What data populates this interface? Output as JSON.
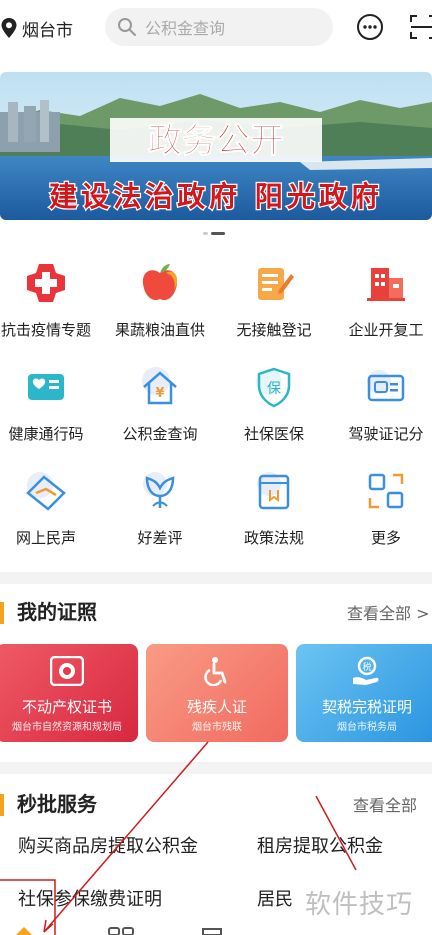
{
  "header": {
    "location": "烟台市",
    "search_placeholder": "公积金查询",
    "icons": [
      "location-pin-icon",
      "search-icon",
      "message-icon",
      "scan-icon"
    ]
  },
  "banner": {
    "title": "政务公开",
    "subtitle": "建设法治政府 阳光政府",
    "slides": 2,
    "active_slide": 2
  },
  "grid": [
    {
      "label": "抗击疫情专题",
      "icon": "medical-cross-icon",
      "color": "#e8343a"
    },
    {
      "label": "果蔬粮油直供",
      "icon": "apple-icon",
      "color": "#ef4a3c"
    },
    {
      "label": "无接触登记",
      "icon": "notepad-pen-icon",
      "color": "#f39a33"
    },
    {
      "label": "企业开复工",
      "icon": "building-icon",
      "color": "#e8403a"
    },
    {
      "label": "健康通行码",
      "icon": "health-card-icon",
      "color": "#2bb6c9"
    },
    {
      "label": "公积金查询",
      "icon": "house-yuan-icon",
      "color": "#3b8fe0"
    },
    {
      "label": "社保医保",
      "icon": "shield-bao-icon",
      "color": "#2bb6c9"
    },
    {
      "label": "驾驶证记分",
      "icon": "license-card-icon",
      "color": "#3b8fe0"
    },
    {
      "label": "网上民声",
      "icon": "mail-icon",
      "color": "#3b8fe0"
    },
    {
      "label": "好差评",
      "icon": "flower-icon",
      "color": "#3b8fe0"
    },
    {
      "label": "政策法规",
      "icon": "book-icon",
      "color": "#3b8fe0"
    },
    {
      "label": "更多",
      "icon": "more-blocks-icon",
      "color": "#3b8fe0"
    }
  ],
  "certificates": {
    "title": "我的证照",
    "more": "查看全部 >",
    "cards": [
      {
        "title": "不动产权证书",
        "sub": "烟台市自然资源和规划局",
        "color": "#e23d4e"
      },
      {
        "title": "残疾人证",
        "sub": "烟台市残联",
        "color": "#f47b6e"
      },
      {
        "title": "契税完税证明",
        "sub": "烟台市税务局",
        "color": "#3aa7e6"
      }
    ]
  },
  "quick_services": {
    "title": "秒批服务",
    "more": "查看全部",
    "items": [
      "购买商品房提取公积金",
      "租房提取公积金",
      "社保参保缴费证明",
      "居民"
    ]
  },
  "watermark": "软件技巧"
}
